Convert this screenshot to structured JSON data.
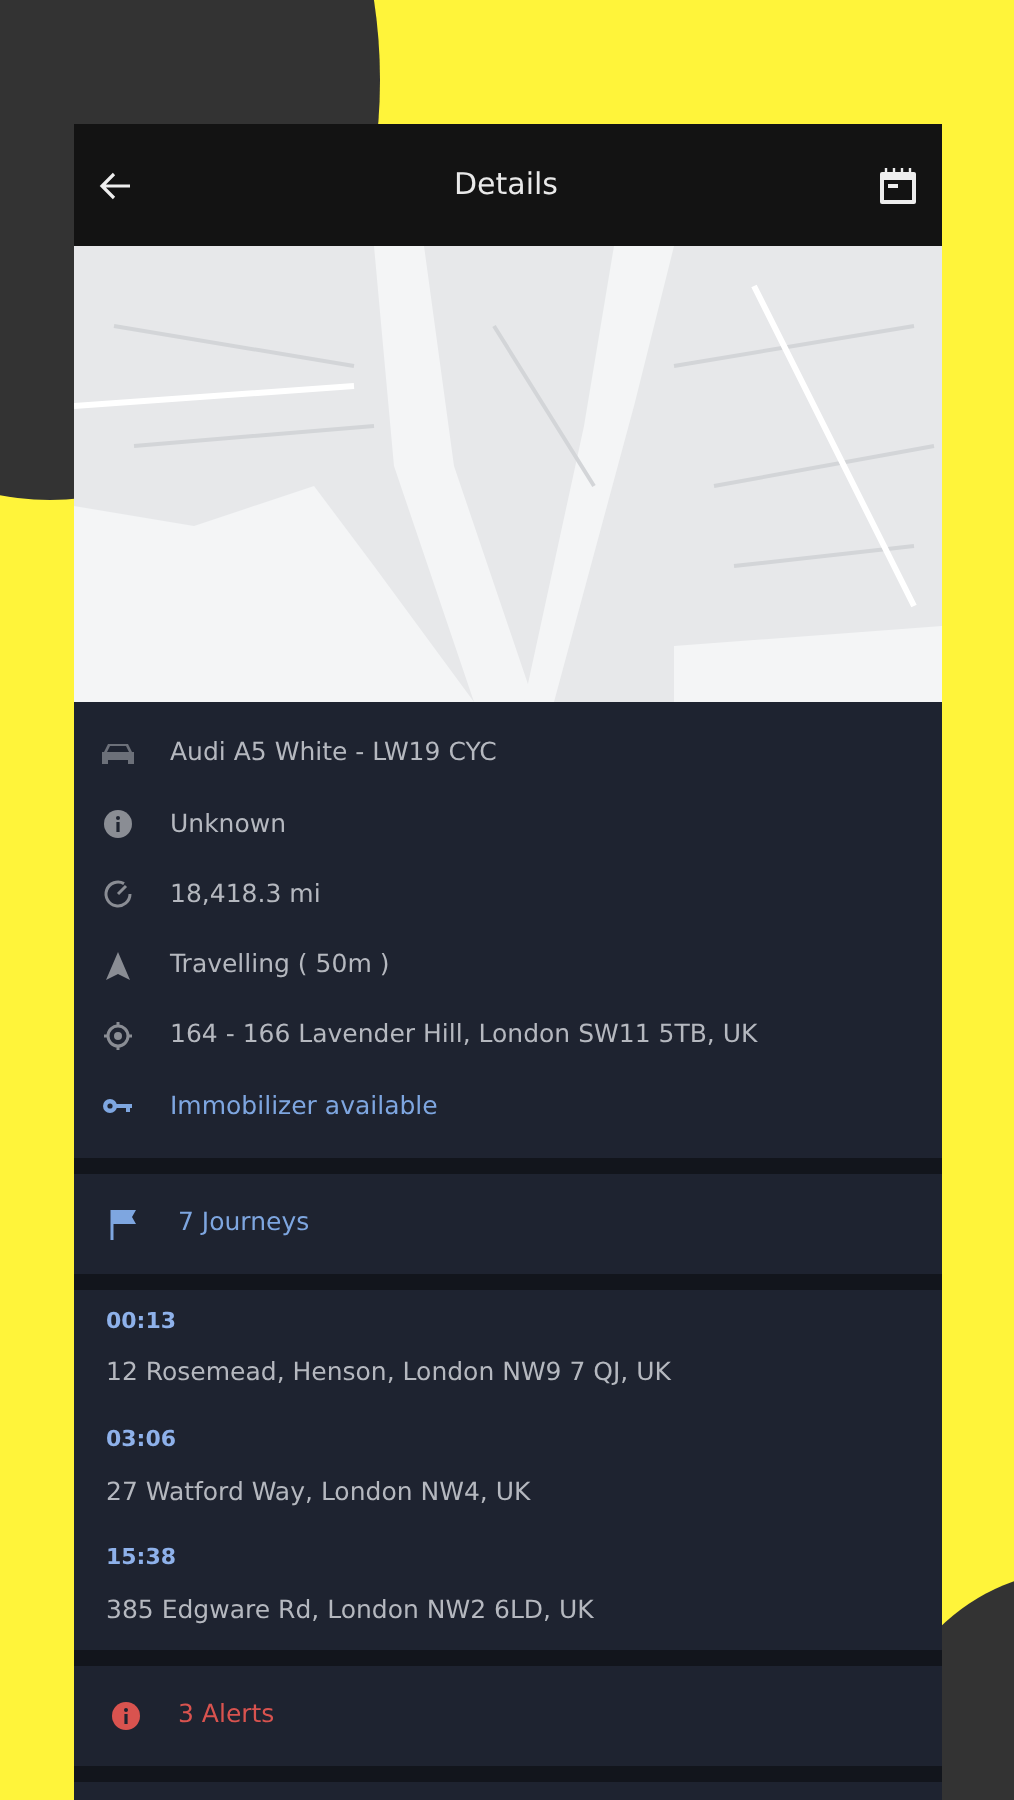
{
  "header": {
    "title": "Details"
  },
  "vehicle_info": [
    {
      "kind": "car",
      "text": "Audi A5 White - LW19 CYC",
      "accent": false
    },
    {
      "kind": "info",
      "text": "Unknown",
      "accent": false
    },
    {
      "kind": "gauge",
      "text": "18,418.3 mi",
      "accent": false
    },
    {
      "kind": "navigation",
      "text": "Travelling ( 50m )",
      "accent": false
    },
    {
      "kind": "location",
      "text": "164 - 166 Lavender Hill, London SW11 5TB, UK",
      "accent": false
    },
    {
      "kind": "key",
      "text": "Immobilizer available",
      "accent": true
    }
  ],
  "journeys": {
    "label": "7 Journeys",
    "items": [
      {
        "time": "00:13",
        "address": "12 Rosemead, Henson, London NW9 7 QJ, UK"
      },
      {
        "time": "03:06",
        "address": "27 Watford Way, London NW4, UK"
      },
      {
        "time": "15:38",
        "address": "385 Edgware Rd, London NW2 6LD, UK"
      }
    ]
  },
  "alerts": {
    "label": "3 Alerts"
  }
}
